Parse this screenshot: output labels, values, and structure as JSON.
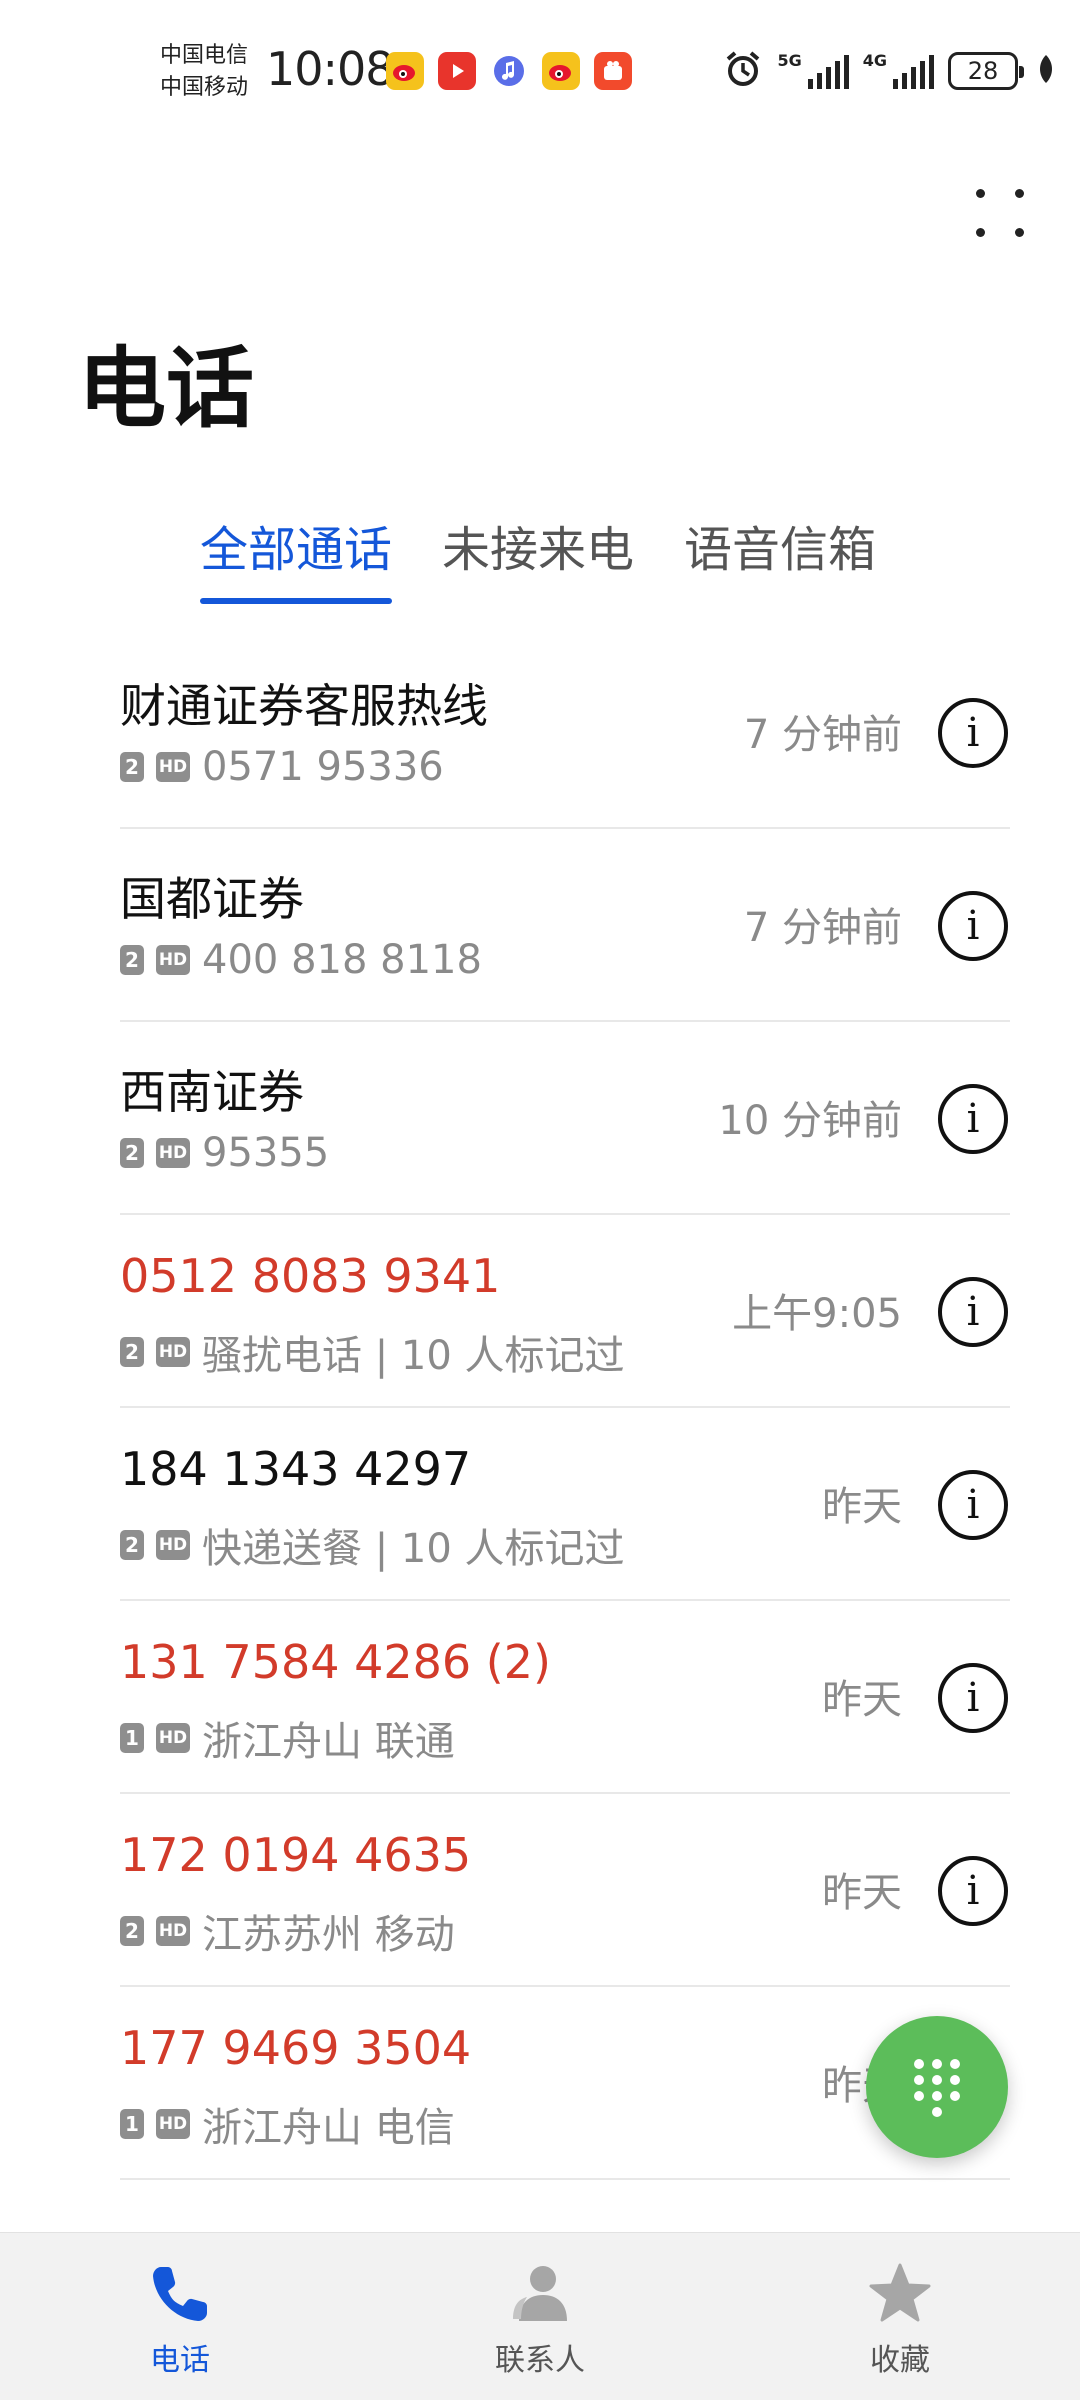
{
  "status_bar": {
    "carrier_1": "中国电信",
    "carrier_2": "中国移动",
    "time": "10:08",
    "net_1": "5G",
    "net_2": "4G",
    "battery": "28"
  },
  "page": {
    "title": "电话"
  },
  "tabs": [
    {
      "label": "全部通话",
      "active": true
    },
    {
      "label": "未接来电",
      "active": false
    },
    {
      "label": "语音信箱",
      "active": false
    }
  ],
  "calls": [
    {
      "name": "财通证券客服热线",
      "sim": "2",
      "hd": "HD",
      "detail": "0571 95336",
      "time": "7 分钟前",
      "missed": false
    },
    {
      "name": "国都证券",
      "sim": "2",
      "hd": "HD",
      "detail": "400 818 8118",
      "time": "7 分钟前",
      "missed": false
    },
    {
      "name": "西南证券",
      "sim": "2",
      "hd": "HD",
      "detail": "95355",
      "time": "10 分钟前",
      "missed": false
    },
    {
      "name": "0512 8083 9341",
      "sim": "2",
      "hd": "HD",
      "detail": "骚扰电话 | 10 人标记过",
      "time": "上午9:05",
      "missed": true
    },
    {
      "name": "184 1343 4297",
      "sim": "2",
      "hd": "HD",
      "detail": "快递送餐 | 10 人标记过",
      "time": "昨天",
      "missed": false
    },
    {
      "name": "131 7584 4286 (2)",
      "sim": "1",
      "hd": "HD",
      "detail": "浙江舟山 联通",
      "time": "昨天",
      "missed": true
    },
    {
      "name": "172 0194 4635",
      "sim": "2",
      "hd": "HD",
      "detail": "江苏苏州 移动",
      "time": "昨天",
      "missed": true
    },
    {
      "name": "177 9469 3504",
      "sim": "1",
      "hd": "HD",
      "detail": "浙江舟山 电信",
      "time": "昨天",
      "missed": true
    }
  ],
  "bottom_nav": [
    {
      "label": "电话",
      "icon": "phone-icon",
      "active": true
    },
    {
      "label": "联系人",
      "icon": "person-icon",
      "active": false
    },
    {
      "label": "收藏",
      "icon": "star-icon",
      "active": false
    }
  ],
  "colors": {
    "accent": "#1457d9",
    "missed": "#d23b2a",
    "fab": "#5cbd5a"
  }
}
